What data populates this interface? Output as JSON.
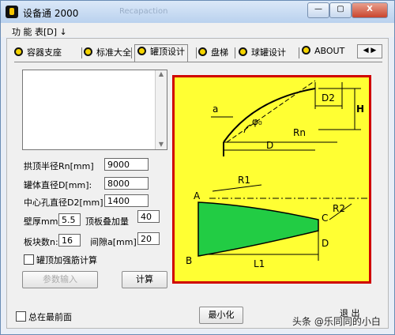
{
  "window": {
    "title": "设备通 2000",
    "ghost_title": "Recapaction",
    "buttons": [
      "—",
      "▢",
      "X"
    ]
  },
  "menu": {
    "label": "功 能 表[D] ↓"
  },
  "tabs": [
    "容器支座",
    "标准大全",
    "罐顶设计",
    "盘梯",
    "球罐设计",
    "ABOUT"
  ],
  "tab_arrows": "◀ ▶",
  "list_scroll": {
    "up": "▲",
    "down": "▼"
  },
  "fields": {
    "rn_label": "拱顶半径Rn[mm]",
    "rn_value": "9000",
    "d_label": "罐体直径D[mm]:",
    "d_value": "8000",
    "d2_label": "中心孔直径D2[mm]",
    "d2_value": "1400",
    "thk_label": "壁厚mm:",
    "thk_value": "5.5",
    "overlap_label": "顶板叠加量",
    "overlap_value": "40",
    "count_label": "板块数n:",
    "count_value": "16",
    "gap_label": "间隙a[mm]:",
    "gap_value": "20"
  },
  "checkbox": {
    "label": "罐顶加强筋计算",
    "checked": false
  },
  "buttons": {
    "input_params": "参数输入",
    "calculate": "计算"
  },
  "diagram": {
    "labels": {
      "a": "a",
      "phi": "φ₀",
      "d2": "D2",
      "h": "H",
      "rn": "Rn",
      "d": "D",
      "r1": "R1",
      "r2": "R2",
      "A": "A",
      "B": "B",
      "C": "C",
      "D": "D",
      "l1": "L1"
    },
    "colors": {
      "background": "#ffff33",
      "border": "#d00000",
      "plate": "#22cc44",
      "line": "#000000"
    }
  },
  "footer": {
    "always_on_top": "总在最前面",
    "always_on_top_checked": false,
    "minimize": "最小化",
    "exit": "退 出"
  },
  "watermark": "头条 @乐同同的小白"
}
